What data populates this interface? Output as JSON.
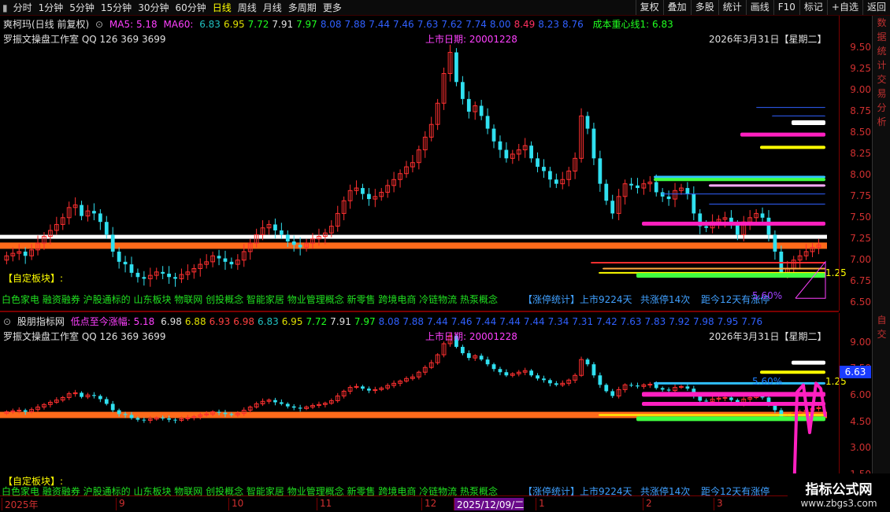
{
  "toolbar": {
    "left": [
      "分时",
      "1分钟",
      "5分钟",
      "15分钟",
      "30分钟",
      "60分钟",
      "日线",
      "周线",
      "月线",
      "多周期",
      "更多"
    ],
    "active": "日线",
    "right": [
      "复权",
      "叠加",
      "多股",
      "统计",
      "画线",
      "F10",
      "标记",
      "+自选",
      "返回"
    ]
  },
  "main_legend": {
    "stock": "爽柯玛(日线 前复权)",
    "ma5_label": "MA5: 5.18",
    "ma60_label": "MA60:",
    "ma_values": [
      {
        "v": "6.83",
        "c": "#20c0c0"
      },
      {
        "v": "6.95",
        "c": "#e0e000"
      },
      {
        "v": "7.72",
        "c": "#20ff20"
      },
      {
        "v": "7.91",
        "c": "#e0e0e0"
      },
      {
        "v": "7.97",
        "c": "#20ff20"
      },
      {
        "v": "8.08",
        "c": "#3060ff"
      },
      {
        "v": "7.88",
        "c": "#3060ff"
      },
      {
        "v": "7.44",
        "c": "#3060ff"
      },
      {
        "v": "7.46",
        "c": "#3060ff"
      },
      {
        "v": "7.63",
        "c": "#3060ff"
      },
      {
        "v": "7.62",
        "c": "#3060ff"
      },
      {
        "v": "7.74",
        "c": "#3060ff"
      },
      {
        "v": "8.00",
        "c": "#3060ff"
      },
      {
        "v": "8.49",
        "c": "#ff3060"
      },
      {
        "v": "8.23",
        "c": "#3060ff"
      },
      {
        "v": "8.76",
        "c": "#3060ff"
      }
    ],
    "center_line": "成本重心线1: 6.83"
  },
  "studio_line": "罗振文操盘工作室 QQ 126 369 3699",
  "listing_date": "上市日期: 20001228",
  "date_label": "2026年3月31日【星期二】",
  "custom_block_label": "【自定板块】:",
  "sectors": "白色家电 融资融券 沪股通标的 山东板块 物联网 创投概念 智能家居 物业管理概念 新零售 跨境电商 冷链物流 热泵概念",
  "limit_stats": "【涨停统计】上市9224天",
  "limit_count": "共涨停14次",
  "limit_days": "距今12天有涨停",
  "pct_label": "5.60%",
  "tag_25": "1.25",
  "sub_legend": {
    "name": "股朋指标网",
    "title": "低点至今涨幅: 5.18",
    "values": [
      {
        "v": "6.98",
        "c": "#e0e0e0"
      },
      {
        "v": "6.88",
        "c": "#e0e000"
      },
      {
        "v": "6.93",
        "c": "#ff4040"
      },
      {
        "v": "6.98",
        "c": "#ff4040"
      },
      {
        "v": "6.83",
        "c": "#20c0c0"
      },
      {
        "v": "6.95",
        "c": "#e0e000"
      },
      {
        "v": "7.72",
        "c": "#20ff20"
      },
      {
        "v": "7.91",
        "c": "#e0e0e0"
      },
      {
        "v": "7.97",
        "c": "#20ff20"
      },
      {
        "v": "8.08",
        "c": "#3060ff"
      },
      {
        "v": "7.88",
        "c": "#3060ff"
      },
      {
        "v": "7.44",
        "c": "#3060ff"
      },
      {
        "v": "7.46",
        "c": "#3060ff"
      },
      {
        "v": "7.44",
        "c": "#3060ff"
      },
      {
        "v": "7.44",
        "c": "#3060ff"
      },
      {
        "v": "7.44",
        "c": "#3060ff"
      },
      {
        "v": "7.34",
        "c": "#3060ff"
      },
      {
        "v": "7.31",
        "c": "#3060ff"
      },
      {
        "v": "7.42",
        "c": "#3060ff"
      },
      {
        "v": "7.63",
        "c": "#3060ff"
      },
      {
        "v": "7.83",
        "c": "#3060ff"
      },
      {
        "v": "7.92",
        "c": "#3060ff"
      },
      {
        "v": "7.98",
        "c": "#3060ff"
      },
      {
        "v": "7.95",
        "c": "#3060ff"
      },
      {
        "v": "7.76",
        "c": "#3060ff"
      }
    ]
  },
  "sub_price_tag": "6.63",
  "main_axis": [
    "9.50",
    "9.25",
    "9.00",
    "8.75",
    "8.50",
    "8.25",
    "8.00",
    "7.75",
    "7.50",
    "7.25",
    "7.00",
    "6.75",
    "6.50"
  ],
  "sub_axis": [
    "9.00",
    "7.50",
    "6.00",
    "4.50",
    "3.00",
    "1.50"
  ],
  "side_labels": [
    "数",
    "据",
    "统",
    "计",
    "交",
    "易",
    "分",
    "析"
  ],
  "side_sub_labels": [
    "自",
    "交"
  ],
  "time_axis": [
    "2025年",
    "9",
    "10",
    "11",
    "12",
    "2025/12/09/二",
    "1",
    "2",
    "3"
  ],
  "watermark": {
    "title": "指标公式网",
    "url": "www.zbgs3.com"
  },
  "colors": {
    "up": "#ff3030",
    "down": "#30e0f0",
    "orange": "#ff6a1a",
    "magenta": "#ff20c0"
  },
  "chart_data": {
    "type": "candlestick",
    "yrange_main": [
      6.45,
      9.65
    ],
    "yrange_sub": [
      0.5,
      9.8
    ],
    "closes": [
      7.05,
      7.08,
      7.1,
      7.05,
      7.12,
      7.2,
      7.28,
      7.35,
      7.42,
      7.5,
      7.62,
      7.65,
      7.52,
      7.58,
      7.55,
      7.45,
      7.3,
      7.1,
      6.98,
      6.95,
      6.85,
      6.8,
      6.78,
      6.82,
      6.86,
      6.84,
      6.8,
      6.78,
      6.83,
      6.86,
      6.9,
      6.95,
      6.98,
      7.05,
      7.02,
      6.98,
      6.95,
      7.0,
      7.1,
      7.2,
      7.3,
      7.38,
      7.42,
      7.35,
      7.3,
      7.22,
      7.18,
      7.15,
      7.2,
      7.25,
      7.28,
      7.32,
      7.4,
      7.55,
      7.7,
      7.82,
      7.85,
      7.78,
      7.72,
      7.75,
      7.8,
      7.88,
      7.95,
      8.02,
      8.1,
      8.15,
      8.3,
      8.45,
      8.6,
      8.85,
      9.2,
      9.45,
      9.1,
      8.9,
      8.75,
      8.82,
      8.7,
      8.55,
      8.4,
      8.3,
      8.2,
      8.25,
      8.3,
      8.35,
      8.2,
      8.1,
      8.05,
      7.95,
      7.9,
      7.95,
      8.05,
      8.2,
      8.7,
      8.55,
      8.2,
      7.9,
      7.7,
      7.55,
      7.75,
      7.9,
      7.88,
      7.85,
      7.9,
      7.92,
      7.8,
      7.75,
      7.72,
      7.82,
      7.85,
      7.78,
      7.55,
      7.4,
      7.38,
      7.45,
      7.48,
      7.5,
      7.42,
      7.3,
      7.45,
      7.5,
      7.55,
      7.5,
      7.3,
      7.1,
      6.85,
      6.9,
      7.0,
      7.05,
      7.1,
      7.15,
      7.18
    ]
  }
}
